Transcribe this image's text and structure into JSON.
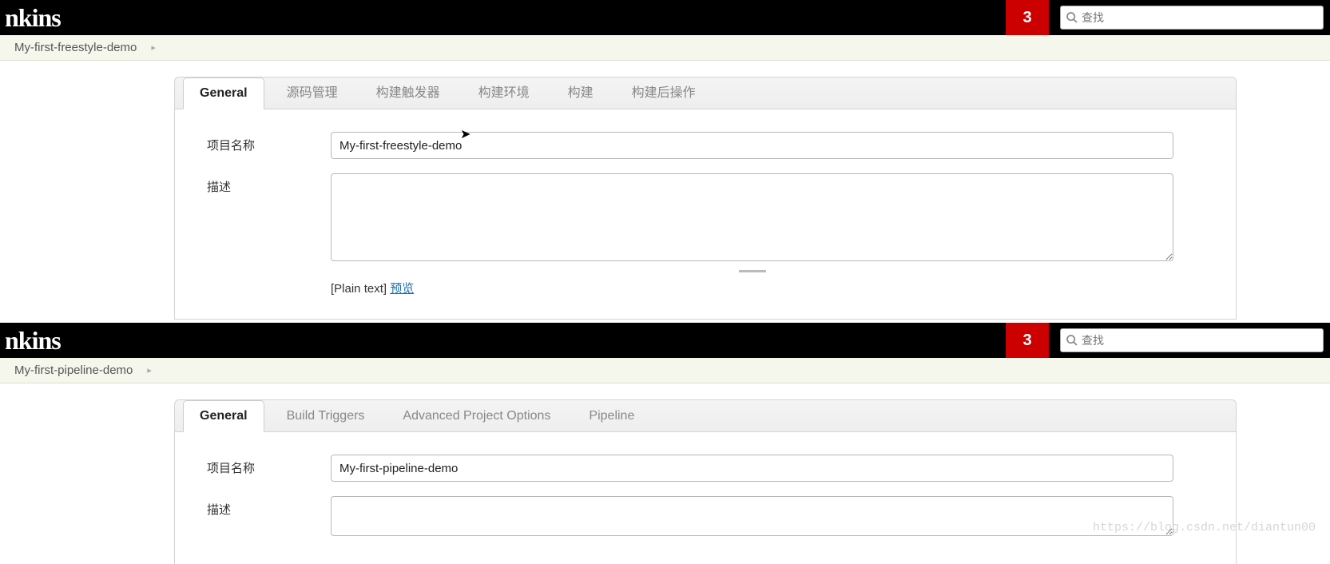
{
  "header": {
    "logo": "nkins",
    "notif_count": "3",
    "search_placeholder": "查找"
  },
  "section1": {
    "breadcrumb": "My-first-freestyle-demo",
    "tabs": [
      {
        "label": "General",
        "active": true
      },
      {
        "label": "源码管理",
        "active": false
      },
      {
        "label": "构建触发器",
        "active": false
      },
      {
        "label": "构建环境",
        "active": false
      },
      {
        "label": "构建",
        "active": false
      },
      {
        "label": "构建后操作",
        "active": false
      }
    ],
    "project_name_label": "项目名称",
    "project_name_value": "My-first-freestyle-demo",
    "description_label": "描述",
    "description_value": "",
    "format_hint_prefix": "[Plain text] ",
    "preview_link": "预览"
  },
  "section2": {
    "breadcrumb": "My-first-pipeline-demo",
    "tabs": [
      {
        "label": "General",
        "active": true
      },
      {
        "label": "Build Triggers",
        "active": false
      },
      {
        "label": "Advanced Project Options",
        "active": false
      },
      {
        "label": "Pipeline",
        "active": false
      }
    ],
    "project_name_label": "项目名称",
    "project_name_value": "My-first-pipeline-demo",
    "description_label": "描述",
    "description_value": ""
  },
  "watermark": "https://blog.csdn.net/diantun00"
}
